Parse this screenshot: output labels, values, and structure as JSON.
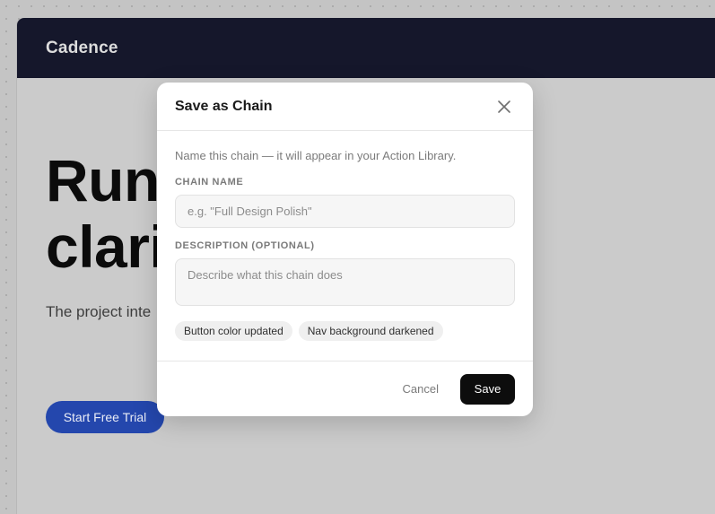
{
  "app": {
    "brand": "Cadence",
    "hero_title": "Run         with\nclari",
    "hero_subtitle": "The project inte",
    "cta_label": "Start Free Trial"
  },
  "modal": {
    "title": "Save as Chain",
    "helper_text": "Name this chain — it will appear in your Action Library.",
    "name_label": "CHAIN NAME",
    "name_placeholder": "e.g. \"Full Design Polish\"",
    "name_value": "",
    "description_label": "DESCRIPTION (OPTIONAL)",
    "description_placeholder": "Describe what this chain does",
    "description_value": "",
    "chips": [
      {
        "label": "Button color updated"
      },
      {
        "label": "Nav background darkened"
      }
    ],
    "cancel_label": "Cancel",
    "save_label": "Save"
  },
  "icons": {
    "close": "close-icon"
  },
  "colors": {
    "topbar": "#15172b",
    "cta": "#2447ad",
    "save_button": "#0d0d0d",
    "overlay_bg": "#c4c4c4"
  }
}
